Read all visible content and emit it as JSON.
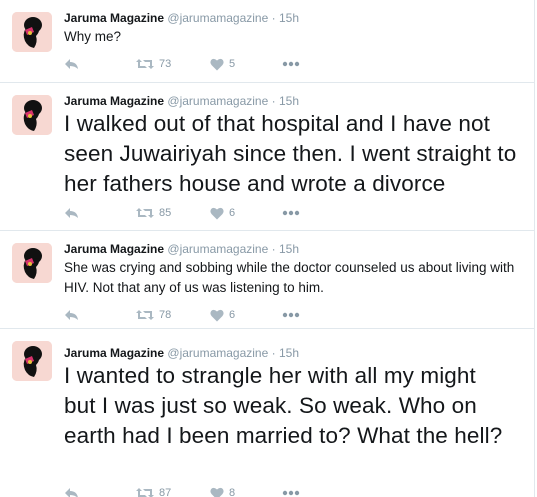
{
  "tweets": [
    {
      "name": "Jaruma Magazine",
      "handle": "@jarumamagazine",
      "separator": "·",
      "time": "15h",
      "text": "Why me?",
      "retweets": "73",
      "likes": "5"
    },
    {
      "name": "Jaruma Magazine",
      "handle": "@jarumamagazine",
      "separator": "·",
      "time": "15h",
      "text": "I walked out of that hospital and I have not seen Juwairiyah since then. I went straight to her fathers house and wrote a divorce",
      "retweets": "85",
      "likes": "6"
    },
    {
      "name": "Jaruma Magazine",
      "handle": "@jarumamagazine",
      "separator": "·",
      "time": "15h",
      "text": "She was crying and sobbing while the doctor counseled us about living with HIV. Not that any of us was listening to him.",
      "retweets": "78",
      "likes": "6"
    },
    {
      "name": "Jaruma Magazine",
      "handle": "@jarumamagazine",
      "separator": "·",
      "time": "15h",
      "text": "I wanted to strangle her with all my might but I was just so weak. So weak. Who on earth had I been married to? What the hell?",
      "retweets": "87",
      "likes": "8"
    }
  ],
  "icons": {
    "reply": "reply-icon",
    "retweet": "retweet-icon",
    "like": "heart-icon",
    "more": "more-icon"
  },
  "colors": {
    "name": "#14171a",
    "meta": "#8899a6",
    "action": "#aab8c2",
    "divider": "#e1e8ed",
    "avatar_bg": "#f7d8d2"
  }
}
